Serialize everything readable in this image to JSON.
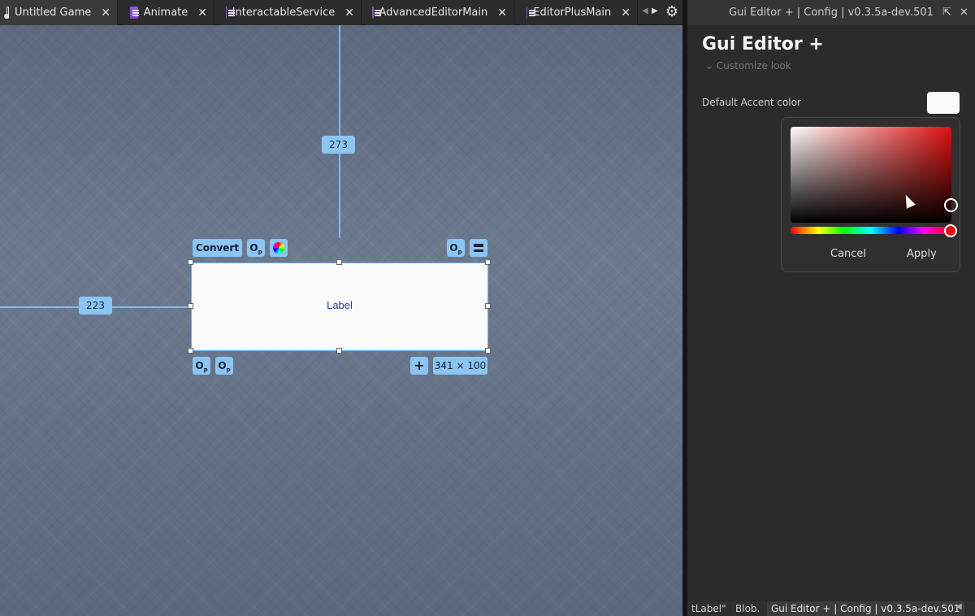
{
  "tabs": [
    {
      "label": "Untitled Game",
      "icon": "document-icon",
      "active": true
    },
    {
      "label": "Animate",
      "icon": "script-icon"
    },
    {
      "label": "InteractableService",
      "icon": "script-icon"
    },
    {
      "label": "AdvancedEditorMain",
      "icon": "script-icon"
    },
    {
      "label": "EditorPlusMain",
      "icon": "script-icon"
    }
  ],
  "tab_close_glyph": "✕",
  "viewport": {
    "vertical_distance": "273",
    "horizontal_distance": "223",
    "label_text": "Label",
    "size_readout": "341 × 100",
    "convert_label": "Convert",
    "offset_glyph": "O",
    "offset_sub": "p",
    "add_glyph": "+"
  },
  "panel": {
    "window_title": "Gui Editor + | Config | v0.3.5a-dev.501",
    "title": "Gui Editor +",
    "section": "Customize look",
    "accent_label": "Default Accent color",
    "accent_color": "#fafafa",
    "picker": {
      "hue_color": "#e01010",
      "cancel_label": "Cancel",
      "apply_label": "Apply"
    }
  },
  "bottom_tabs": [
    "tLabel\"",
    "Blob.",
    "Gui Editor + | Config | v0.3.5a-dev.501"
  ]
}
